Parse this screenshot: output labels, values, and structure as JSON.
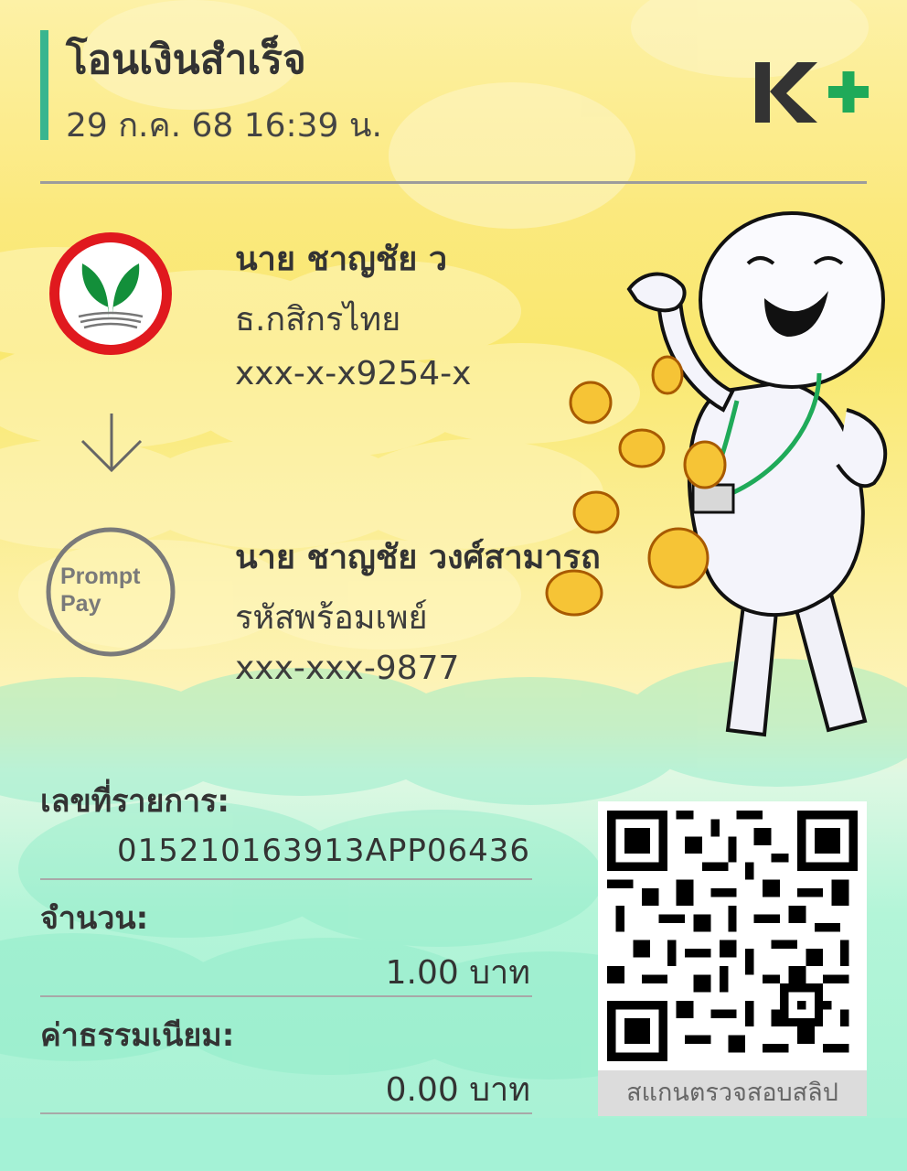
{
  "header": {
    "title": "โอนเงินสำเร็จ",
    "datetime": "29 ก.ค. 68  16:39 น.",
    "brand_logo": "K+",
    "accent_color": "#39b58f"
  },
  "sender": {
    "name": "นาย ชาญชัย ว",
    "bank": "ธ.กสิกรไทย",
    "account": "xxx-x-x9254-x",
    "logo_icon": "kbank-logo-icon",
    "logo_color": "#e0191e"
  },
  "transfer_arrow_icon": "arrow-down-icon",
  "receiver": {
    "name": "นาย ชาญชัย วงศ์สามารถ",
    "channel": "รหัสพร้อมเพย์",
    "account": "xxx-xxx-9877",
    "logo_icon": "promptpay-logo-icon",
    "logo_text_line1": "Prompt",
    "logo_text_line2": "Pay"
  },
  "details": {
    "ref_label": "เลขที่รายการ:",
    "ref_value": "015210163913APP06436",
    "amount_label": "จำนวน:",
    "amount_value": "1.00 บาท",
    "fee_label": "ค่าธรรมเนียม:",
    "fee_value": "0.00 บาท"
  },
  "qr": {
    "icon": "qr-code-icon",
    "caption": "สแกนตรวจสอบสลิป"
  },
  "decoration": {
    "character": "character-throwing-coins"
  }
}
